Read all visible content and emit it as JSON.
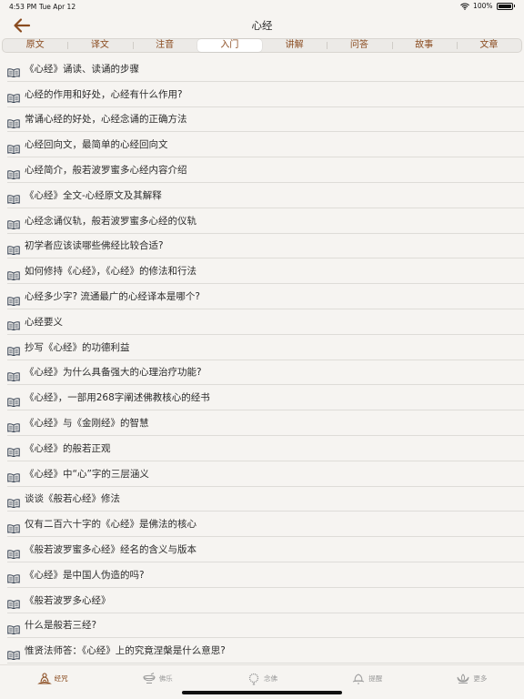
{
  "status_bar": {
    "time": "4:53 PM",
    "date": "Tue Apr 12",
    "battery": "100%"
  },
  "header": {
    "title": "心经"
  },
  "tabs": [
    {
      "label": "原文",
      "active": false
    },
    {
      "label": "译文",
      "active": false
    },
    {
      "label": "注音",
      "active": false
    },
    {
      "label": "入门",
      "active": true
    },
    {
      "label": "讲解",
      "active": false
    },
    {
      "label": "问答",
      "active": false
    },
    {
      "label": "故事",
      "active": false
    },
    {
      "label": "文章",
      "active": false
    }
  ],
  "list": {
    "icon": "open-book-icon",
    "items": [
      "《心经》诵读、读诵的步骤",
      "心经的作用和好处，心经有什么作用?",
      "常诵心经的好处，心经念诵的正确方法",
      "心经回向文，最简单的心经回向文",
      "心经简介，般若波罗蜜多心经内容介绍",
      "《心经》全文-心经原文及其解释",
      "心经念诵仪轨，般若波罗蜜多心经的仪轨",
      "初学者应该读哪些佛经比较合适?",
      "如何修持《心经》，《心经》的修法和行法",
      "心经多少字? 流通最广的心经译本是哪个?",
      "心经要义",
      "抄写《心经》的功德利益",
      "《心经》为什么具备强大的心理治疗功能?",
      "《心经》，一部用268字阐述佛教核心的经书",
      "《心经》与《金刚经》的智慧",
      "《心经》的般若正观",
      "《心经》中“心”字的三层涵义",
      "谈谈《般若心经》修法",
      "仅有二百六十字的《心经》是佛法的核心",
      "《般若波罗蜜多心经》经名的含义与版本",
      "《心经》是中国人伪造的吗?",
      "《般若波罗多心经》",
      "什么是般若三经?",
      "惟贤法师答：《心经》上的究竟涅槃是什么意思?"
    ]
  },
  "tabbar": [
    {
      "label": "经咒",
      "icon": "meditation-figure-icon",
      "active": true
    },
    {
      "label": "佛乐",
      "icon": "bowl-icon",
      "active": false
    },
    {
      "label": "念佛",
      "icon": "prayer-beads-icon",
      "active": false
    },
    {
      "label": "提醒",
      "icon": "lotus-bell-icon",
      "active": false
    },
    {
      "label": "更多",
      "icon": "lotus-icon",
      "active": false
    }
  ],
  "colors": {
    "accent": "#8a4b1f",
    "background": "#f6f4f1",
    "inactive": "#9a9a9a"
  }
}
